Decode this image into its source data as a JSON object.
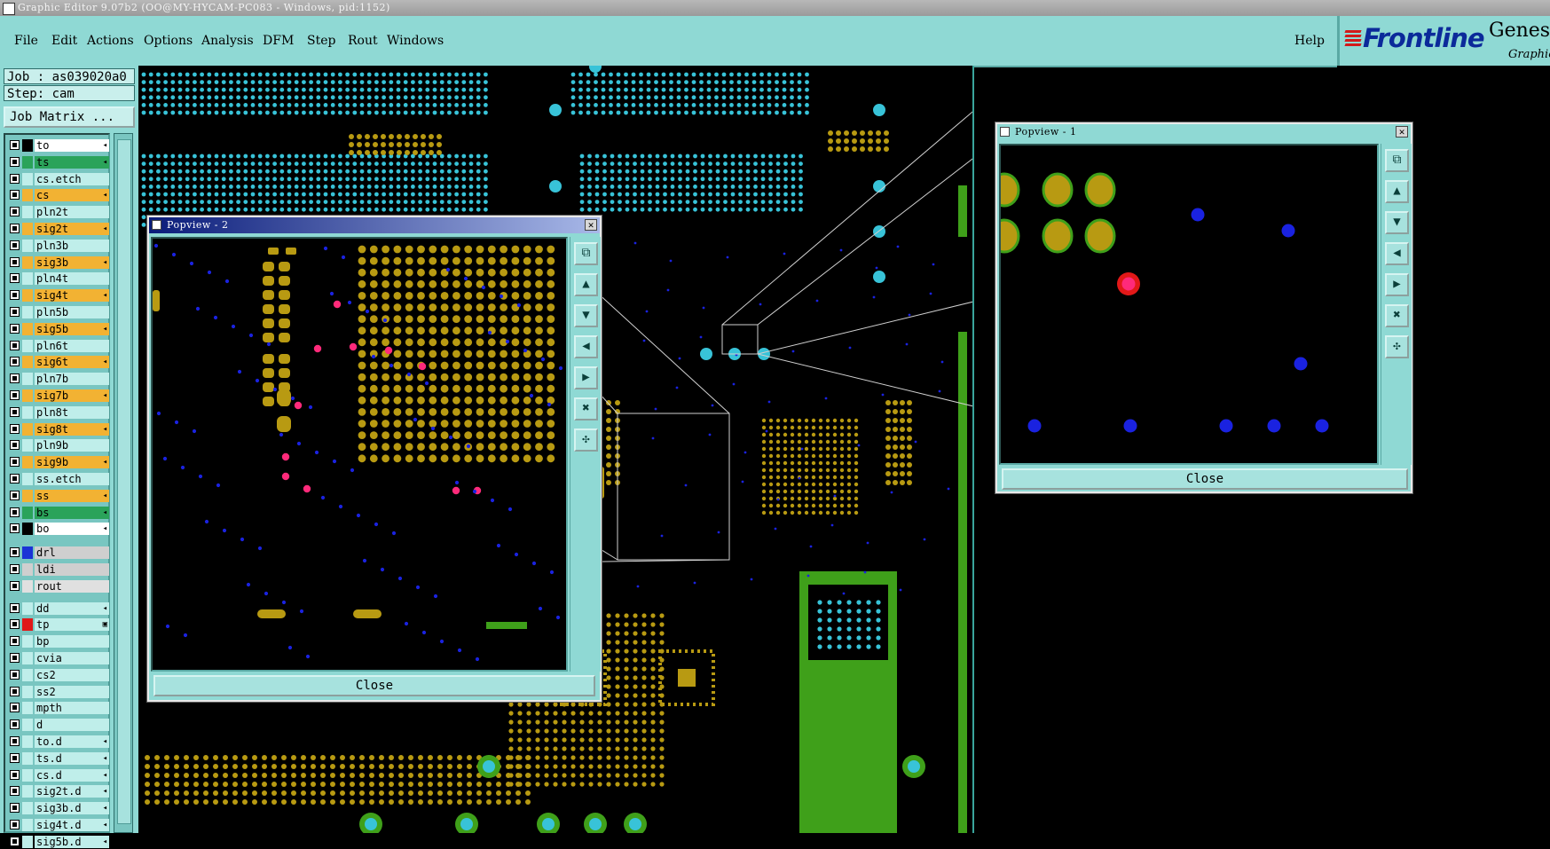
{
  "window": {
    "title": "Graphic Editor 9.07b2 (OO@MY-HYCAM-PC083 - Windows, pid:1152)"
  },
  "menu": [
    "File",
    "Edit",
    "Actions",
    "Options",
    "Analysis",
    "DFM",
    "Step",
    "Rout",
    "Windows"
  ],
  "help": "Help",
  "brand": {
    "logo": "Frontline",
    "product": "Genesi",
    "subtitle": "Graphic"
  },
  "job": {
    "job_line": "Job : as039020a0",
    "step_line": "Step: cam",
    "matrix_button": "Job Matrix ..."
  },
  "layers": [
    {
      "name": "to",
      "color": "#ffffff",
      "sw": "#000000",
      "arrow": "◂"
    },
    {
      "name": "ts",
      "color": "#2aa35a",
      "sw": "#2aa35a",
      "arrow": "◂"
    },
    {
      "name": "cs.etch",
      "color": "#bfeeea",
      "sw": "#bfeeea",
      "arrow": ""
    },
    {
      "name": "cs",
      "color": "#f2b233",
      "sw": "#f2b233",
      "arrow": "◂"
    },
    {
      "name": "pln2t",
      "color": "#bfeeea",
      "sw": "#bfeeea",
      "arrow": ""
    },
    {
      "name": "sig2t",
      "color": "#f2b233",
      "sw": "#f2b233",
      "arrow": "◂"
    },
    {
      "name": "pln3b",
      "color": "#bfeeea",
      "sw": "#bfeeea",
      "arrow": ""
    },
    {
      "name": "sig3b",
      "color": "#f2b233",
      "sw": "#f2b233",
      "arrow": "◂"
    },
    {
      "name": "pln4t",
      "color": "#bfeeea",
      "sw": "#bfeeea",
      "arrow": ""
    },
    {
      "name": "sig4t",
      "color": "#f2b233",
      "sw": "#f2b233",
      "arrow": "◂"
    },
    {
      "name": "pln5b",
      "color": "#bfeeea",
      "sw": "#bfeeea",
      "arrow": ""
    },
    {
      "name": "sig5b",
      "color": "#f2b233",
      "sw": "#f2b233",
      "arrow": "◂"
    },
    {
      "name": "pln6t",
      "color": "#bfeeea",
      "sw": "#bfeeea",
      "arrow": ""
    },
    {
      "name": "sig6t",
      "color": "#f2b233",
      "sw": "#f2b233",
      "arrow": "◂"
    },
    {
      "name": "pln7b",
      "color": "#bfeeea",
      "sw": "#bfeeea",
      "arrow": ""
    },
    {
      "name": "sig7b",
      "color": "#f2b233",
      "sw": "#f2b233",
      "arrow": "◂"
    },
    {
      "name": "pln8t",
      "color": "#bfeeea",
      "sw": "#bfeeea",
      "arrow": ""
    },
    {
      "name": "sig8t",
      "color": "#f2b233",
      "sw": "#f2b233",
      "arrow": "◂"
    },
    {
      "name": "pln9b",
      "color": "#bfeeea",
      "sw": "#bfeeea",
      "arrow": ""
    },
    {
      "name": "sig9b",
      "color": "#f2b233",
      "sw": "#f2b233",
      "arrow": "◂"
    },
    {
      "name": "ss.etch",
      "color": "#bfeeea",
      "sw": "#bfeeea",
      "arrow": ""
    },
    {
      "name": "ss",
      "color": "#f2b233",
      "sw": "#f2b233",
      "arrow": "◂"
    },
    {
      "name": "bs",
      "color": "#2aa35a",
      "sw": "#2aa35a",
      "arrow": "◂"
    },
    {
      "name": "bo",
      "color": "#ffffff",
      "sw": "#000000",
      "arrow": "◂"
    },
    {
      "name": "drl",
      "color": "#cfcfcf",
      "sw": "#1a33d6",
      "arrow": ""
    },
    {
      "name": "ldi",
      "color": "#cfcfcf",
      "sw": "#cfcfcf",
      "arrow": ""
    },
    {
      "name": "rout",
      "color": "#e0e0e0",
      "sw": "#e0e0e0",
      "arrow": ""
    },
    {
      "name": "dd",
      "color": "#bfeeea",
      "sw": "#bfeeea",
      "arrow": "◂"
    },
    {
      "name": "tp",
      "color": "#bfeeea",
      "sw": "#e01818",
      "arrow": "▣"
    },
    {
      "name": "bp",
      "color": "#bfeeea",
      "sw": "#bfeeea",
      "arrow": ""
    },
    {
      "name": "cvia",
      "color": "#bfeeea",
      "sw": "#bfeeea",
      "arrow": ""
    },
    {
      "name": "cs2",
      "color": "#bfeeea",
      "sw": "#bfeeea",
      "arrow": ""
    },
    {
      "name": "ss2",
      "color": "#bfeeea",
      "sw": "#bfeeea",
      "arrow": ""
    },
    {
      "name": "mpth",
      "color": "#bfeeea",
      "sw": "#bfeeea",
      "arrow": ""
    },
    {
      "name": "d",
      "color": "#bfeeea",
      "sw": "#bfeeea",
      "arrow": ""
    },
    {
      "name": "to.d",
      "color": "#bfeeea",
      "sw": "#bfeeea",
      "arrow": "◂"
    },
    {
      "name": "ts.d",
      "color": "#bfeeea",
      "sw": "#bfeeea",
      "arrow": "◂"
    },
    {
      "name": "cs.d",
      "color": "#bfeeea",
      "sw": "#bfeeea",
      "arrow": "◂"
    },
    {
      "name": "sig2t.d",
      "color": "#bfeeea",
      "sw": "#bfeeea",
      "arrow": "◂"
    },
    {
      "name": "sig3b.d",
      "color": "#bfeeea",
      "sw": "#bfeeea",
      "arrow": "◂"
    },
    {
      "name": "sig4t.d",
      "color": "#bfeeea",
      "sw": "#bfeeea",
      "arrow": "◂"
    },
    {
      "name": "sig5b.d",
      "color": "#bfeeea",
      "sw": "#bfeeea",
      "arrow": "◂"
    }
  ],
  "popview2": {
    "title": "Popview - 2",
    "close_x": "✕",
    "close_button": "Close"
  },
  "popview1": {
    "title": "Popview - 1",
    "close_x": "✕",
    "close_button": "Close"
  },
  "colors": {
    "pad": "#b89a12",
    "pad_edge": "#3fa01a",
    "via": "#38c3d8",
    "blue_via": "#1a22e0",
    "highlight": "#ff2a7a",
    "board_green": "#3fa01a"
  }
}
